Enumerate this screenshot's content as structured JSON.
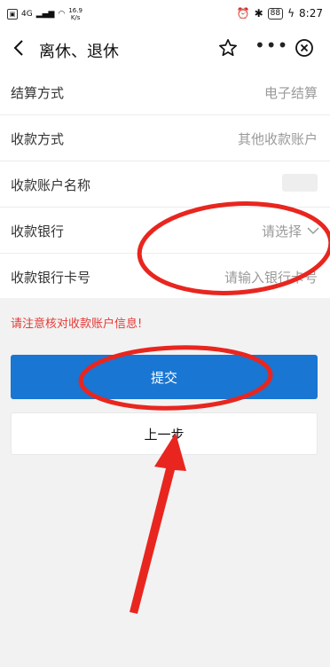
{
  "status": {
    "network": "4G",
    "speed_top": "16.9",
    "speed_unit": "K/s",
    "battery": "88",
    "time": "8:27"
  },
  "header": {
    "title": "离休、退休"
  },
  "form": {
    "rows": [
      {
        "label": "结算方式",
        "value": "电子结算"
      },
      {
        "label": "收款方式",
        "value": "其他收款账户"
      },
      {
        "label": "收款账户名称",
        "value": ""
      },
      {
        "label": "收款银行",
        "value": "请选择"
      },
      {
        "label": "收款银行卡号",
        "placeholder": "请输入银行卡号"
      }
    ]
  },
  "warning": "请注意核对收款账户信息!",
  "buttons": {
    "submit": "提交",
    "previous": "上一步"
  },
  "colors": {
    "primary": "#1976d2",
    "warning": "#e53935",
    "annotation": "#e8261f"
  },
  "icons": [
    "back-icon",
    "star-icon",
    "more-icon",
    "close-icon",
    "chevron-down-icon"
  ]
}
